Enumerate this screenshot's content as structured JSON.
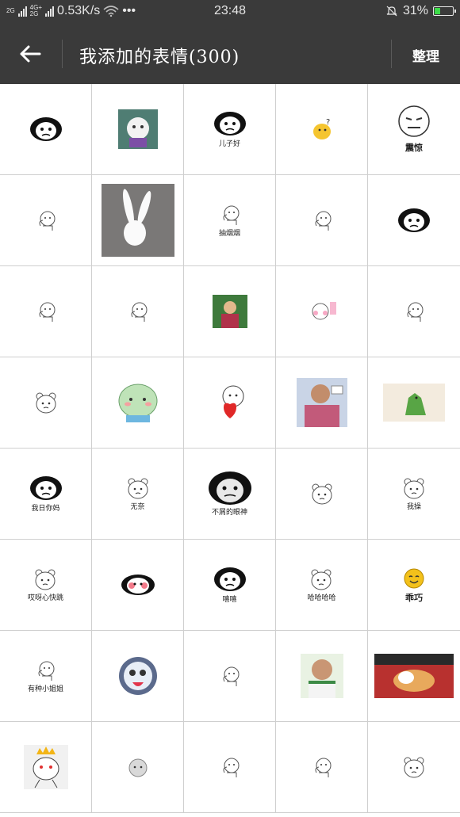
{
  "status_bar": {
    "net_top": "2G",
    "net_mid_top": "4G+",
    "net_mid_bottom": "2G",
    "speed": "0.53K/s",
    "more": "•••",
    "time": "23:48",
    "battery_percent": "31%",
    "battery_level": 0.31,
    "battery_color": "#3ddc49"
  },
  "header": {
    "title": "我添加的表情(300)",
    "action_label": "整理",
    "back_icon": "arrow-left-icon",
    "background": "#3a3a3a"
  },
  "stickers": [
    {
      "kind": "panda",
      "caption": ""
    },
    {
      "kind": "photo-cartoon",
      "caption": ""
    },
    {
      "kind": "panda",
      "caption": "儿子好"
    },
    {
      "kind": "yellow-chick",
      "caption": ""
    },
    {
      "kind": "rage-face",
      "caption": "震惊"
    },
    {
      "kind": "doodle",
      "caption": ""
    },
    {
      "kind": "rabbit-photo",
      "caption": ""
    },
    {
      "kind": "doodle",
      "caption": "抽烟烟"
    },
    {
      "kind": "doodle",
      "caption": ""
    },
    {
      "kind": "panda",
      "caption": ""
    },
    {
      "kind": "doodle",
      "caption": ""
    },
    {
      "kind": "doodle",
      "caption": ""
    },
    {
      "kind": "kid-photo",
      "caption": ""
    },
    {
      "kind": "doodle-pink",
      "caption": ""
    },
    {
      "kind": "doodle",
      "caption": ""
    },
    {
      "kind": "bear",
      "caption": ""
    },
    {
      "kind": "green-blob",
      "caption": ""
    },
    {
      "kind": "heart-doodle",
      "caption": ""
    },
    {
      "kind": "man-photo",
      "caption": ""
    },
    {
      "kind": "green-dino",
      "caption": ""
    },
    {
      "kind": "panda",
      "caption": "我日你妈"
    },
    {
      "kind": "bear",
      "caption": "无奈"
    },
    {
      "kind": "panda-big",
      "caption": "不屑的眼神"
    },
    {
      "kind": "bear",
      "caption": ""
    },
    {
      "kind": "bear",
      "caption": "我操"
    },
    {
      "kind": "bear",
      "caption": "哎呀心快跳"
    },
    {
      "kind": "panda-blush",
      "caption": ""
    },
    {
      "kind": "panda",
      "caption": "嘻嘻"
    },
    {
      "kind": "bear",
      "caption": "哈哈哈哈"
    },
    {
      "kind": "yellow-smile",
      "caption": "乖巧"
    },
    {
      "kind": "doodle",
      "caption": "有种小姐姐"
    },
    {
      "kind": "blue-cartoon",
      "caption": ""
    },
    {
      "kind": "doodle",
      "caption": ""
    },
    {
      "kind": "fat-man-photo",
      "caption": ""
    },
    {
      "kind": "cat-photo",
      "caption": ""
    },
    {
      "kind": "crown-rabbit",
      "caption": ""
    },
    {
      "kind": "bear-gray",
      "caption": ""
    },
    {
      "kind": "doodle",
      "caption": ""
    },
    {
      "kind": "doodle",
      "caption": ""
    },
    {
      "kind": "bear",
      "caption": ""
    }
  ]
}
